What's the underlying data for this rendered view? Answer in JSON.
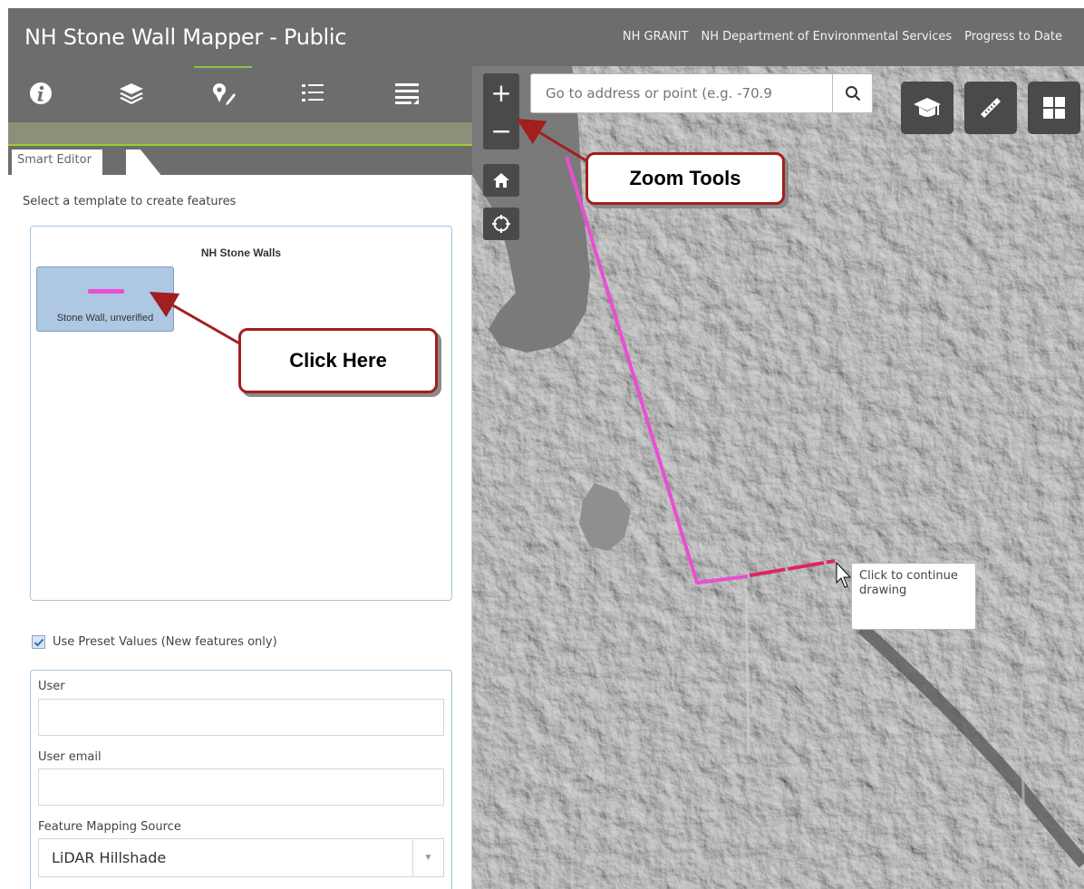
{
  "header": {
    "title": "NH Stone Wall Mapper - Public",
    "links": [
      "NH GRANIT",
      "NH Department of Environmental Services",
      "Progress to Date"
    ]
  },
  "toolbar": {
    "tools": [
      "info-icon",
      "layers-icon",
      "edit-icon",
      "legend-icon",
      "list-icon"
    ],
    "active_tool": "edit-icon"
  },
  "panel": {
    "tab_label": "Smart Editor",
    "instruction": "Select a template to create features",
    "layer_name": "NH Stone Walls",
    "template_label": "Stone Wall, unverified",
    "preset_label": "Use Preset Values (New features only)",
    "fields": {
      "user_label": "User",
      "user_value": "",
      "email_label": "User email",
      "email_value": "",
      "source_label": "Feature Mapping Source",
      "source_value": "LiDAR Hillshade"
    }
  },
  "map": {
    "search_placeholder": "Go to address or point (e.g. -70.9",
    "zoom_in": "+",
    "zoom_out": "−",
    "tooltip": "Click to continue drawing",
    "line_color": "#e84fd2",
    "active_segment_color": "#e0245e"
  },
  "callouts": {
    "zoom_tools": "Zoom Tools",
    "click_here": "Click Here"
  },
  "colors": {
    "header_bg": "#6d6d6d",
    "accent_green": "#8bc34a",
    "callout_border": "#a21f1f"
  }
}
